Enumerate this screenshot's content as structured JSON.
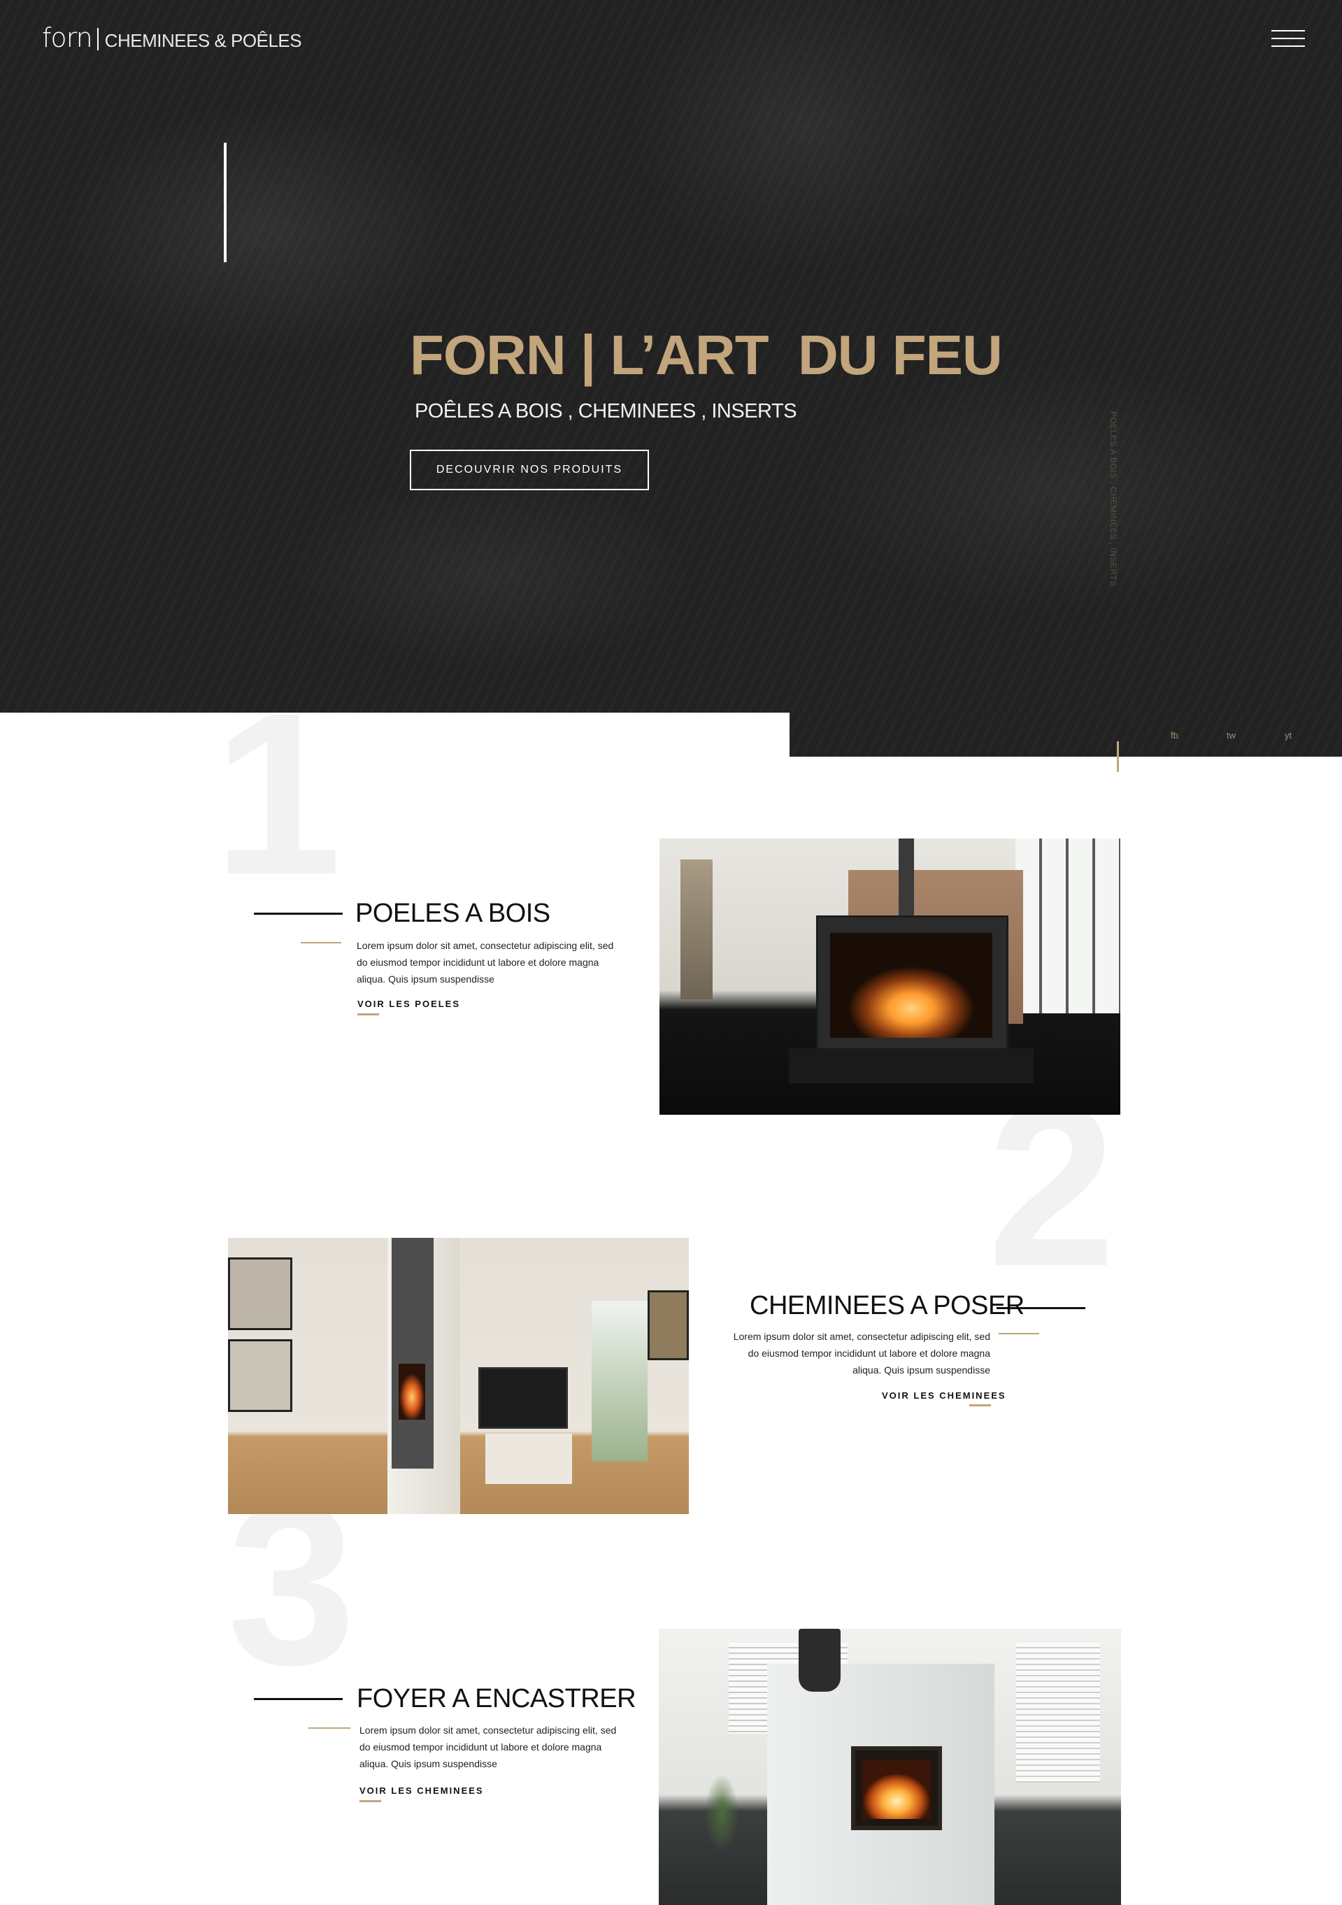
{
  "header": {
    "logo_mark": "forn",
    "logo_sub": "CHEMINEES & POÊLES",
    "menu_icon": "hamburger-icon"
  },
  "hero": {
    "title": "FORN | L’ART  DU FEU",
    "subtitle": "POÊLES A BOIS , CHEMINEES , INSERTS",
    "cta_label": "DECOUVRIR NOS PRODUITS",
    "vertical_text": "POELES A BOIS , CHEMINEES , INSERTS"
  },
  "social": {
    "fb": "fb",
    "tw": "tw",
    "yt": "yt"
  },
  "sections": [
    {
      "number": "1",
      "title": "POELES A BOIS",
      "description": "Lorem ipsum dolor sit amet, consectetur adipiscing elit, sed do eiusmod tempor incididunt ut labore et dolore magna aliqua. Quis ipsum suspendisse",
      "link_label": "VOIR LES POELES"
    },
    {
      "number": "2",
      "title": "CHEMINEES A POSER",
      "description": "Lorem ipsum dolor sit amet, consectetur adipiscing elit, sed do eiusmod tempor incididunt ut labore et dolore magna aliqua. Quis ipsum suspendisse",
      "link_label": "VOIR LES CHEMINEES"
    },
    {
      "number": "3",
      "title": "FOYER A ENCASTRER",
      "description": "Lorem ipsum dolor sit amet, consectetur adipiscing elit, sed do eiusmod tempor incididunt ut labore et dolore magna aliqua. Quis ipsum suspendisse",
      "link_label": "VOIR LES CHEMINEES"
    }
  ],
  "colors": {
    "accent_gold": "#c2a57c",
    "hero_bg": "#222222",
    "number_watermark": "#f2f2f2"
  }
}
